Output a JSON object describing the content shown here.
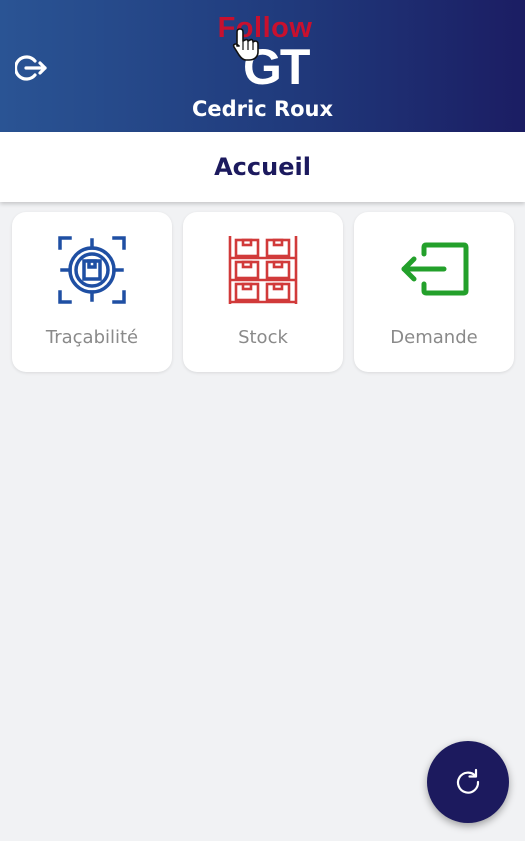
{
  "header": {
    "logo_top": "Follow",
    "logo_bottom": "GT",
    "user_name": "Cedric Roux",
    "logout_icon": "logout-icon"
  },
  "page": {
    "title": "Accueil"
  },
  "tiles": [
    {
      "label": "Traçabilité",
      "icon": "traceability-target-icon",
      "color": "#1f4fa3"
    },
    {
      "label": "Stock",
      "icon": "stock-shelves-icon",
      "color": "#d13a3a"
    },
    {
      "label": "Demande",
      "icon": "request-exit-icon",
      "color": "#23a02b"
    }
  ],
  "fab": {
    "icon": "refresh-icon"
  },
  "colors": {
    "header_start": "#2a5494",
    "header_end": "#1b1d63",
    "primary": "#1c1a5e",
    "logo_red": "#c8102e"
  }
}
